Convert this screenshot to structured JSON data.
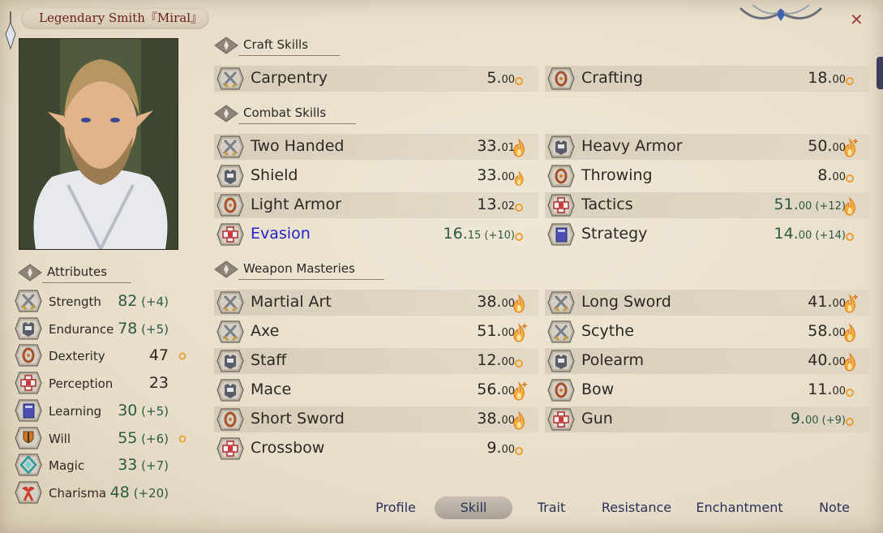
{
  "window": {
    "title": "Legendary Smith『Miral』"
  },
  "sections": {
    "craft": "Craft Skills",
    "combat": "Combat Skills",
    "weapon": "Weapon Masteries",
    "attributes": "Attributes"
  },
  "craft_skills": [
    {
      "name": "Carpentry",
      "level": "5.",
      "frac": "00",
      "bonus": "",
      "icon": "crossed-swords-icon",
      "potential": "low"
    },
    {
      "name": "Crafting",
      "level": "18.",
      "frac": "00",
      "bonus": "",
      "icon": "ring-icon",
      "potential": "low"
    }
  ],
  "combat_skills": [
    {
      "name": "Two Handed",
      "level": "33.",
      "frac": "01",
      "bonus": "",
      "icon": "crossed-swords-icon",
      "potential": "flame"
    },
    {
      "name": "Heavy Armor",
      "level": "50.",
      "frac": "00",
      "bonus": "",
      "icon": "armor-icon",
      "potential": "flame-plus"
    },
    {
      "name": "Shield",
      "level": "33.",
      "frac": "00",
      "bonus": "",
      "icon": "armor-icon",
      "potential": "flame-small"
    },
    {
      "name": "Throwing",
      "level": "8.",
      "frac": "00",
      "bonus": "",
      "icon": "ring-icon",
      "potential": "low"
    },
    {
      "name": "Light Armor",
      "level": "13.",
      "frac": "02",
      "bonus": "",
      "icon": "ring-icon",
      "potential": "low"
    },
    {
      "name": "Tactics",
      "level": "51.",
      "frac": "00",
      "bonus": " (+12)",
      "icon": "cross-icon",
      "potential": "flame"
    },
    {
      "name": "Evasion",
      "level": "16.",
      "frac": "15",
      "bonus": " (+10)",
      "icon": "cross-icon",
      "potential": "low",
      "highlight": true
    },
    {
      "name": "Strategy",
      "level": "14.",
      "frac": "00",
      "bonus": " (+14)",
      "icon": "book-icon",
      "potential": "low"
    }
  ],
  "weapon_masteries": [
    {
      "name": "Martial Art",
      "level": "38.",
      "frac": "00",
      "bonus": "",
      "icon": "crossed-swords-icon",
      "potential": "flame"
    },
    {
      "name": "Long Sword",
      "level": "41.",
      "frac": "00",
      "bonus": "",
      "icon": "crossed-swords-icon",
      "potential": "flame-plus"
    },
    {
      "name": "Axe",
      "level": "51.",
      "frac": "00",
      "bonus": "",
      "icon": "crossed-swords-icon",
      "potential": "flame-plus"
    },
    {
      "name": "Scythe",
      "level": "58.",
      "frac": "00",
      "bonus": "",
      "icon": "crossed-swords-icon",
      "potential": "flame"
    },
    {
      "name": "Staff",
      "level": "12.",
      "frac": "00",
      "bonus": "",
      "icon": "armor-icon",
      "potential": "low"
    },
    {
      "name": "Polearm",
      "level": "40.",
      "frac": "00",
      "bonus": "",
      "icon": "armor-icon",
      "potential": "flame"
    },
    {
      "name": "Mace",
      "level": "56.",
      "frac": "00",
      "bonus": "",
      "icon": "armor-icon",
      "potential": "flame-plus"
    },
    {
      "name": "Bow",
      "level": "11.",
      "frac": "00",
      "bonus": "",
      "icon": "ring-icon",
      "potential": "low"
    },
    {
      "name": "Short Sword",
      "level": "38.",
      "frac": "00",
      "bonus": "",
      "icon": "ring-icon",
      "potential": "flame"
    },
    {
      "name": "Gun",
      "level": "9.",
      "frac": "00",
      "bonus": " (+9)",
      "icon": "cross-icon",
      "potential": "low"
    },
    {
      "name": "Crossbow",
      "level": "9.",
      "frac": "00",
      "bonus": "",
      "icon": "cross-icon",
      "potential": "low"
    }
  ],
  "attributes": [
    {
      "name": "Strength",
      "value": "82",
      "bonus": " (+4)",
      "icon": "crossed-swords-icon",
      "potential": ""
    },
    {
      "name": "Endurance",
      "value": "78",
      "bonus": " (+5)",
      "icon": "armor-icon",
      "potential": ""
    },
    {
      "name": "Dexterity",
      "value": "47",
      "bonus": "",
      "icon": "ring-icon",
      "potential": "low"
    },
    {
      "name": "Perception",
      "value": "23",
      "bonus": "",
      "icon": "cross-icon",
      "potential": ""
    },
    {
      "name": "Learning",
      "value": "30",
      "bonus": " (+5)",
      "icon": "book-icon",
      "potential": ""
    },
    {
      "name": "Will",
      "value": "55",
      "bonus": " (+6)",
      "icon": "shield-icon",
      "potential": "low"
    },
    {
      "name": "Magic",
      "value": "33",
      "bonus": " (+7)",
      "icon": "rune-icon",
      "potential": ""
    },
    {
      "name": "Charisma",
      "value": "48",
      "bonus": " (+20)",
      "icon": "ribbon-icon",
      "potential": ""
    }
  ],
  "tabs": [
    {
      "label": "Profile",
      "active": false
    },
    {
      "label": "Skill",
      "active": true
    },
    {
      "label": "Trait",
      "active": false
    },
    {
      "label": "Resistance",
      "active": false
    },
    {
      "label": "Enchantment",
      "active": false
    },
    {
      "label": "Note",
      "active": false
    }
  ],
  "colors": {
    "accent_title": "#6a1f1a",
    "highlight_skill": "#2222c8",
    "bonus_value": "#2e5a40",
    "tab_text": "#28305a",
    "flame": "#f0a030"
  }
}
